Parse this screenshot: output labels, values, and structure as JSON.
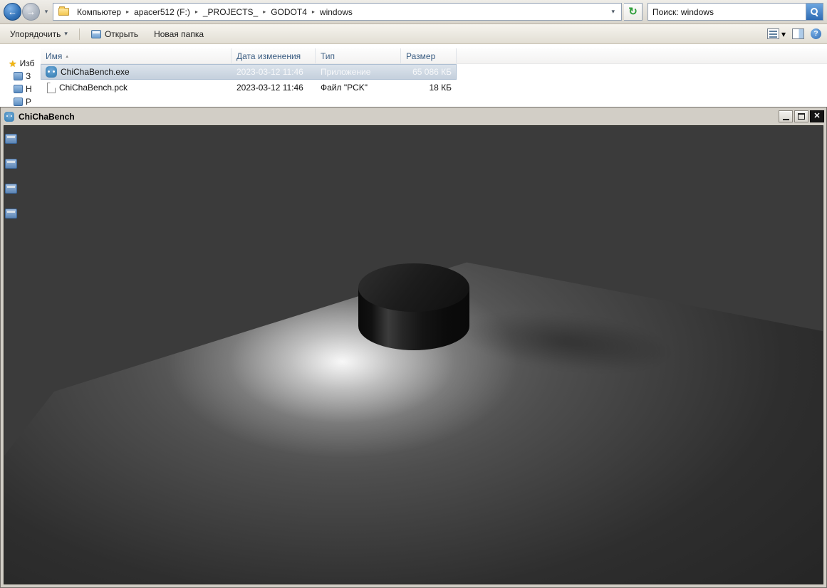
{
  "explorer": {
    "nav": {
      "breadcrumb": [
        "Компьютер",
        "apacer512 (F:)",
        "_PROJECTS_",
        "GODOT4",
        "windows"
      ],
      "search_value": "Поиск: windows"
    },
    "toolbar": {
      "organize": "Упорядочить",
      "open": "Открыть",
      "new_folder": "Новая папка"
    },
    "sidebar": {
      "favorites": "Изб",
      "item1": "З",
      "item2": "Н",
      "item3": "Р"
    },
    "columns": {
      "name": "Имя",
      "date": "Дата изменения",
      "type": "Тип",
      "size": "Размер"
    },
    "files": [
      {
        "name": "ChiChaBench.exe",
        "date": "2023-03-12 11:46",
        "type": "Приложение",
        "size": "65 086 КБ"
      },
      {
        "name": "ChiChaBench.pck",
        "date": "2023-03-12 11:46",
        "type": "Файл \"PCK\"",
        "size": "18 КБ"
      }
    ]
  },
  "game": {
    "title": "ChiChaBench"
  },
  "icons": {
    "back": "←",
    "forward": "→",
    "chevron_down": "▾",
    "crumb_sep": "▸",
    "refresh": "↻",
    "star": "★",
    "sort_asc": "▴",
    "help": "?",
    "close": "✕"
  },
  "colors": {
    "selection_bg": "#c9d4e0",
    "viewport_bg": "#3b3b3b",
    "accent_blue": "#2f6cb4",
    "spotlight": "#ffffff"
  }
}
